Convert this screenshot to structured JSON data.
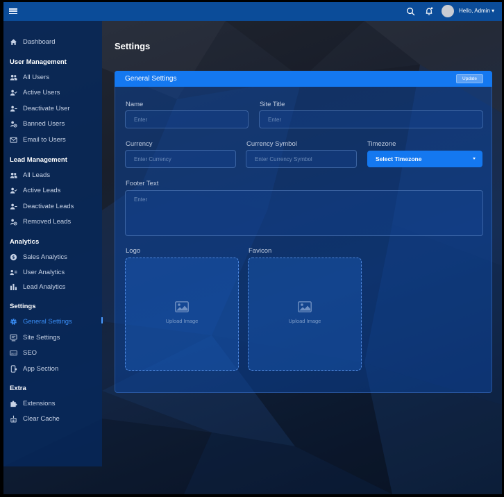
{
  "topbar": {
    "greeting": "Hello, Admin ▾",
    "icons": [
      "menu-icon",
      "search-icon",
      "bell-icon",
      "avatar"
    ]
  },
  "sidebar": {
    "dashboard": "Dashboard",
    "sections": [
      {
        "heading": "User Management",
        "items": [
          "All Users",
          "Active Users",
          "Deactivate User",
          "Banned Users",
          "Email to Users"
        ]
      },
      {
        "heading": "Lead Management",
        "items": [
          "All Leads",
          "Active Leads",
          "Deactivate Leads",
          "Removed Leads"
        ]
      },
      {
        "heading": "Analytics",
        "items": [
          "Sales Analytics",
          "User Analytics",
          "Lead Analytics"
        ]
      },
      {
        "heading": "Settings",
        "items": [
          "General Settings",
          "Site Settings",
          "SEO",
          "App Section"
        ]
      },
      {
        "heading": "Extra",
        "items": [
          "Extensions",
          "Clear Cache"
        ]
      }
    ],
    "active_item": "General Settings"
  },
  "page": {
    "title": "Settings"
  },
  "card": {
    "title": "General Settings",
    "update_label": "Update",
    "fields": {
      "name": {
        "label": "Name",
        "placeholder": "Enter"
      },
      "site_title": {
        "label": "Site Title",
        "placeholder": "Enter"
      },
      "currency": {
        "label": "Currency",
        "placeholder": "Enter Currency"
      },
      "currency_symbol": {
        "label": "Currency Symbol",
        "placeholder": "Enter Currency Symbol"
      },
      "timezone": {
        "label": "Timezone",
        "value": "Select Timezone"
      },
      "footer_text": {
        "label": "Footer Text",
        "placeholder": "Enter"
      },
      "logo": {
        "label": "Logo",
        "upload_text": "Upload Image"
      },
      "favicon": {
        "label": "Favicon",
        "upload_text": "Upload Image"
      }
    }
  },
  "colors": {
    "accent": "#1478f0",
    "topbar": "#0b4c99",
    "sidebar": "#062a5c",
    "active_text": "#3a8df5"
  }
}
